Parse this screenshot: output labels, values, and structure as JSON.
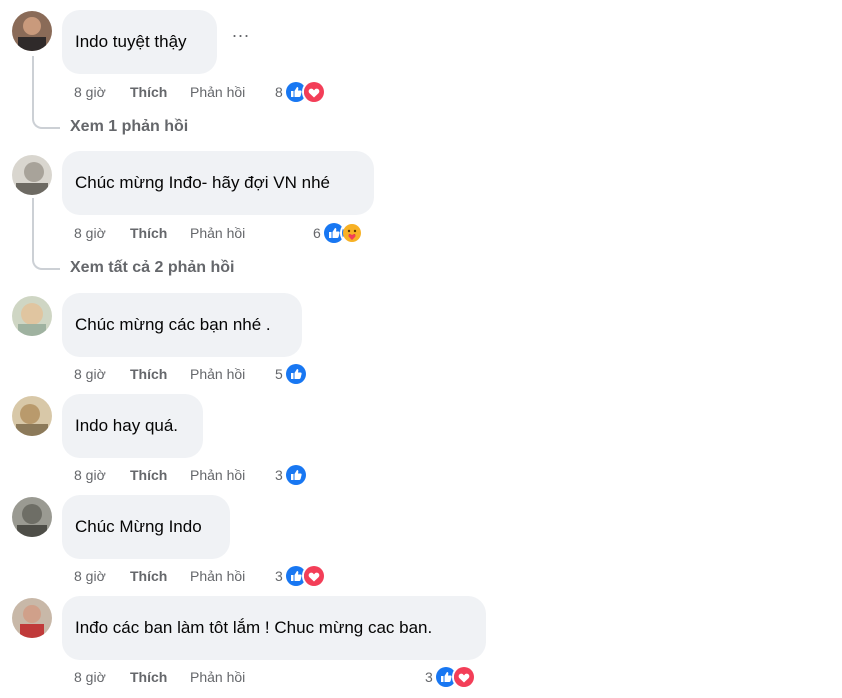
{
  "comments": [
    {
      "text": "Indo tuyệt thậy",
      "time": "8 giờ",
      "like": "Thích",
      "reply": "Phản hồi",
      "count": "8",
      "reactions": [
        "like",
        "love"
      ],
      "more": "...",
      "view_replies": "Xem 1 phản hồi"
    },
    {
      "text": "Chúc mừng Inđo- hãy đợi VN nhé",
      "time": "8 giờ",
      "like": "Thích",
      "reply": "Phản hồi",
      "count": "6",
      "reactions": [
        "like",
        "care"
      ],
      "view_replies": "Xem tất cả 2 phản hồi"
    },
    {
      "text": "Chúc mừng các bạn nhé .",
      "time": "8 giờ",
      "like": "Thích",
      "reply": "Phản hồi",
      "count": "5",
      "reactions": [
        "like"
      ]
    },
    {
      "text": "Indo hay quá.",
      "time": "8 giờ",
      "like": "Thích",
      "reply": "Phản hồi",
      "count": "3",
      "reactions": [
        "like"
      ]
    },
    {
      "text": "Chúc Mừng Indo",
      "time": "8 giờ",
      "like": "Thích",
      "reply": "Phản hồi",
      "count": "3",
      "reactions": [
        "like",
        "love"
      ]
    },
    {
      "text": "Inđo các ban làm tôt lắm ! Chuc mừng cac ban.",
      "time": "8 giờ",
      "like": "Thích",
      "reply": "Phản hồi",
      "count": "3",
      "reactions": [
        "like",
        "love"
      ]
    }
  ],
  "colors": {
    "like": "#1877f2",
    "love": "#f33e58",
    "care": "#f7b125",
    "bubble": "#f0f2f5",
    "meta": "#65676b"
  }
}
